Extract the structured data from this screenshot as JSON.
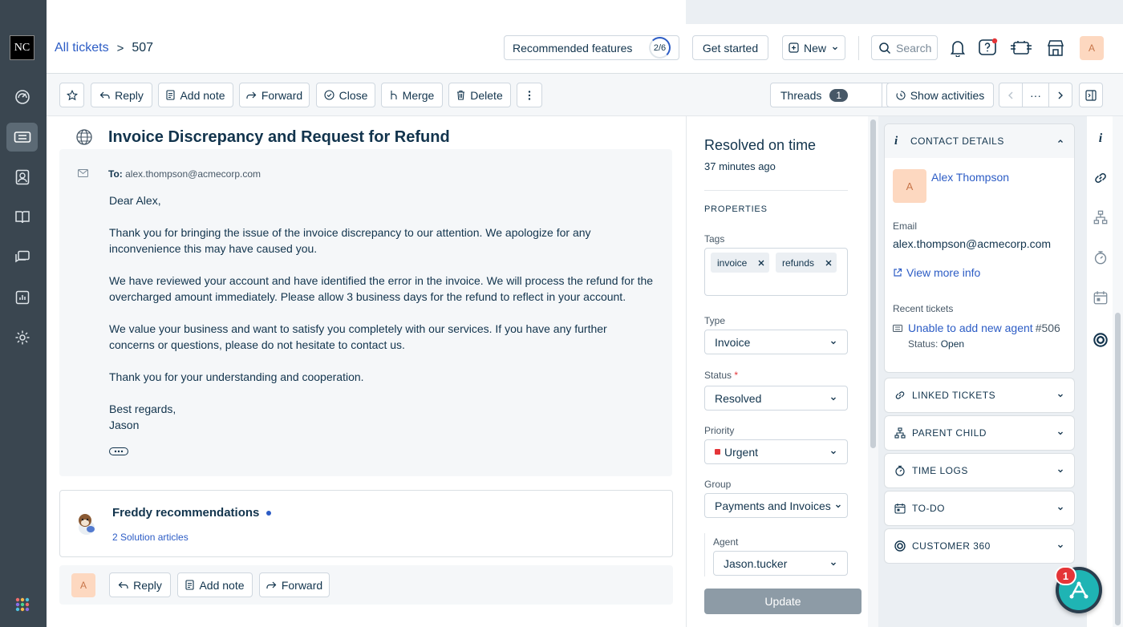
{
  "app": {
    "logo_text": "NC"
  },
  "nav": {
    "items": [
      {
        "icon": "dashboard-icon"
      },
      {
        "icon": "tickets-icon",
        "active": true
      },
      {
        "icon": "contacts-icon"
      },
      {
        "icon": "knowledge-base-icon"
      },
      {
        "icon": "forums-icon"
      },
      {
        "icon": "reports-icon"
      },
      {
        "icon": "settings-icon"
      }
    ],
    "apps_icon": "apps-grid-icon"
  },
  "header": {
    "breadcrumb_root": "All tickets",
    "breadcrumb_sep": ">",
    "ticket_id": "507",
    "recommended_label": "Recommended features",
    "recommended_progress": "2/6",
    "get_started_label": "Get started",
    "new_label": "New",
    "search_placeholder": "Search",
    "avatar_letter": "A"
  },
  "toolbar": {
    "reply": "Reply",
    "add_note": "Add note",
    "forward": "Forward",
    "close": "Close",
    "merge": "Merge",
    "delete": "Delete",
    "threads": "Threads",
    "threads_count": "1",
    "show_activities": "Show activities",
    "more": "···"
  },
  "ticket": {
    "subject": "Invoice Discrepancy and Request for Refund",
    "to_label": "To:",
    "to_email": "alex.thompson@acmecorp.com",
    "body": [
      "Dear Alex,",
      "Thank you for bringing the issue of the invoice discrepancy to our attention. We apologize for any inconvenience this may have caused you.",
      "We have reviewed your account and have identified the error in the invoice. We will process the refund for the overcharged amount immediately. Please allow 3 business days for the refund to reflect in your account.",
      "We value your business and want to satisfy you completely with our services. If you have any further concerns or questions, please do not hesitate to contact us.",
      "Thank you for your understanding and cooperation.",
      "Best regards,",
      "Jason"
    ]
  },
  "freddy": {
    "title": "Freddy recommendations",
    "link": "2 Solution articles"
  },
  "reply_bar": {
    "avatar_letter": "A",
    "reply": "Reply",
    "add_note": "Add note",
    "forward": "Forward"
  },
  "properties": {
    "status_title": "Resolved on time",
    "status_time": "37 minutes ago",
    "heading": "PROPERTIES",
    "tags_label": "Tags",
    "tags": [
      "invoice",
      "refunds"
    ],
    "type_label": "Type",
    "type_value": "Invoice",
    "status_label": "Status",
    "status_value": "Resolved",
    "priority_label": "Priority",
    "priority_value": "Urgent",
    "priority_color": "#e43538",
    "group_label": "Group",
    "group_value": "Payments and Invoices",
    "agent_label": "Agent",
    "agent_value": "Jason.tucker",
    "update_label": "Update"
  },
  "contact": {
    "heading": "CONTACT DETAILS",
    "avatar_letter": "A",
    "name": "Alex Thompson",
    "email_label": "Email",
    "email": "alex.thompson@acmecorp.com",
    "view_more": "View more info",
    "recent_label": "Recent tickets",
    "recent_ticket_title": "Unable to add new agent",
    "recent_ticket_id": "#506",
    "recent_status_label": "Status:",
    "recent_status": "Open"
  },
  "sections": [
    {
      "label": "LINKED TICKETS",
      "icon": "link-icon"
    },
    {
      "label": "PARENT CHILD",
      "icon": "hierarchy-icon"
    },
    {
      "label": "TIME LOGS",
      "icon": "stopwatch-icon"
    },
    {
      "label": "TO-DO",
      "icon": "calendar-icon"
    },
    {
      "label": "CUSTOMER 360",
      "icon": "customer-360-icon"
    }
  ],
  "widget": {
    "badge": "1"
  }
}
